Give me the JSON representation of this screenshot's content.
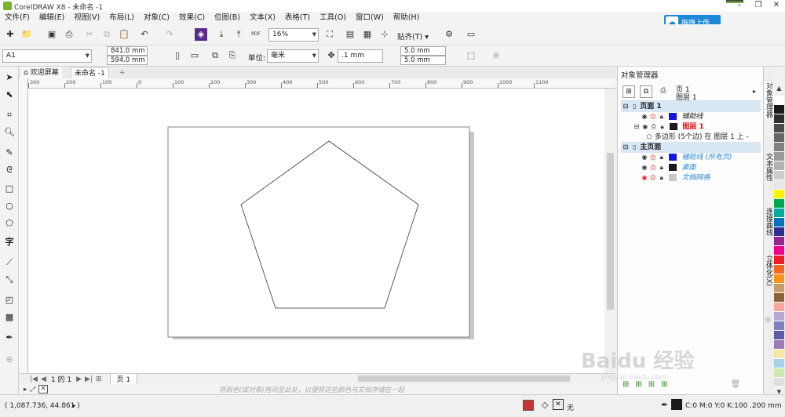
{
  "app": {
    "title": "CorelDRAW X8 - 未命名 -1",
    "minimize": "–",
    "maximize": "❐",
    "close": "✕"
  },
  "menu": [
    "文件(F)",
    "编辑(E)",
    "视图(V)",
    "布局(L)",
    "对象(C)",
    "效果(C)",
    "位图(B)",
    "文本(X)",
    "表格(T)",
    "工具(O)",
    "窗口(W)",
    "帮助(H)"
  ],
  "toolbar": {
    "zoom": "16%",
    "snap_label": "贴齐(T)",
    "upload_label": "拖拽上传",
    "pdf_label": "PDF"
  },
  "propbar": {
    "page_size": "A1",
    "width": "841.0 mm",
    "height": "594.0 mm",
    "units_label": "单位:",
    "units": "毫米",
    "nudge": ".1 mm",
    "dup_x": "5.0 mm",
    "dup_y": "5.0 mm"
  },
  "tabs": {
    "welcome": "欢迎屏幕",
    "document": "未命名 -1",
    "add": "+"
  },
  "ruler": {
    "h_ticks": [
      "300",
      "200",
      "100",
      "0",
      "100",
      "200",
      "300",
      "400",
      "500",
      "600",
      "700",
      "800",
      "900",
      "1000",
      "1100"
    ],
    "unit": "毫米"
  },
  "pagenav": {
    "position": "1 的 1",
    "page_tab": "页 1"
  },
  "colorhint": "将颜色(或对象)拖动至此处，以便将这些颜色与文档存储在一起",
  "docker": {
    "title": "对象管理器",
    "current_page": "页 1",
    "current_layer": "图层 1",
    "tree": [
      {
        "label": "页面 1",
        "level": 0,
        "bold": true,
        "kind": "page"
      },
      {
        "label": "辅助线",
        "level": 1,
        "italic": true,
        "color": "#1515e0",
        "style": "italic"
      },
      {
        "label": "图层 1",
        "level": 1,
        "color": "#1a1a1a",
        "text_color": "#e01010",
        "bold": true
      },
      {
        "label": "多边形 (5个边) 在 图层 1 上 -",
        "level": 2
      },
      {
        "label": "主页面",
        "level": 0,
        "bold": true,
        "kind": "page"
      },
      {
        "label": "辅助线 (所有页)",
        "level": 1,
        "color": "#1515e0",
        "text_color": "#2a8ad6",
        "style": "italic"
      },
      {
        "label": "桌面",
        "level": 1,
        "color": "#1a1a1a",
        "text_color": "#2a8ad6",
        "style": "italic"
      },
      {
        "label": "文档网格",
        "level": 1,
        "color": "#c8c8c8",
        "text_color": "#2a8ad6",
        "style": "italic"
      }
    ]
  },
  "sidetabs": [
    "对象管理器",
    "文本属性",
    "连接曲线",
    "立体化(X)"
  ],
  "palette": [
    "#ffffff",
    "#1a1a1a",
    "#2e2e2e",
    "#4a4a4a",
    "#666666",
    "#808080",
    "#999999",
    "#b3b3b3",
    "#cccccc",
    "#e6e6e6",
    "#fff200",
    "#00a651",
    "#00a99d",
    "#0072bc",
    "#2e3192",
    "#92278f",
    "#ec008c",
    "#ed1c24",
    "#f26522",
    "#f7941d",
    "#c69c6d",
    "#8c6239",
    "#f9a6a0",
    "#b7a7d6",
    "#8080c0",
    "#5b5ba8",
    "#9e7bb5",
    "#f5e6a3",
    "#a3d3e6",
    "#d1e8b0",
    "#e0e0e0"
  ],
  "status": {
    "coords": "( 1,087.736, 44.861 )",
    "fill_none": "无",
    "outline": "C:0 M:0 Y:0 K:100  .200 mm"
  },
  "watermark": "Baidu 经验",
  "watermark_url": "jingyan.baidu.com"
}
